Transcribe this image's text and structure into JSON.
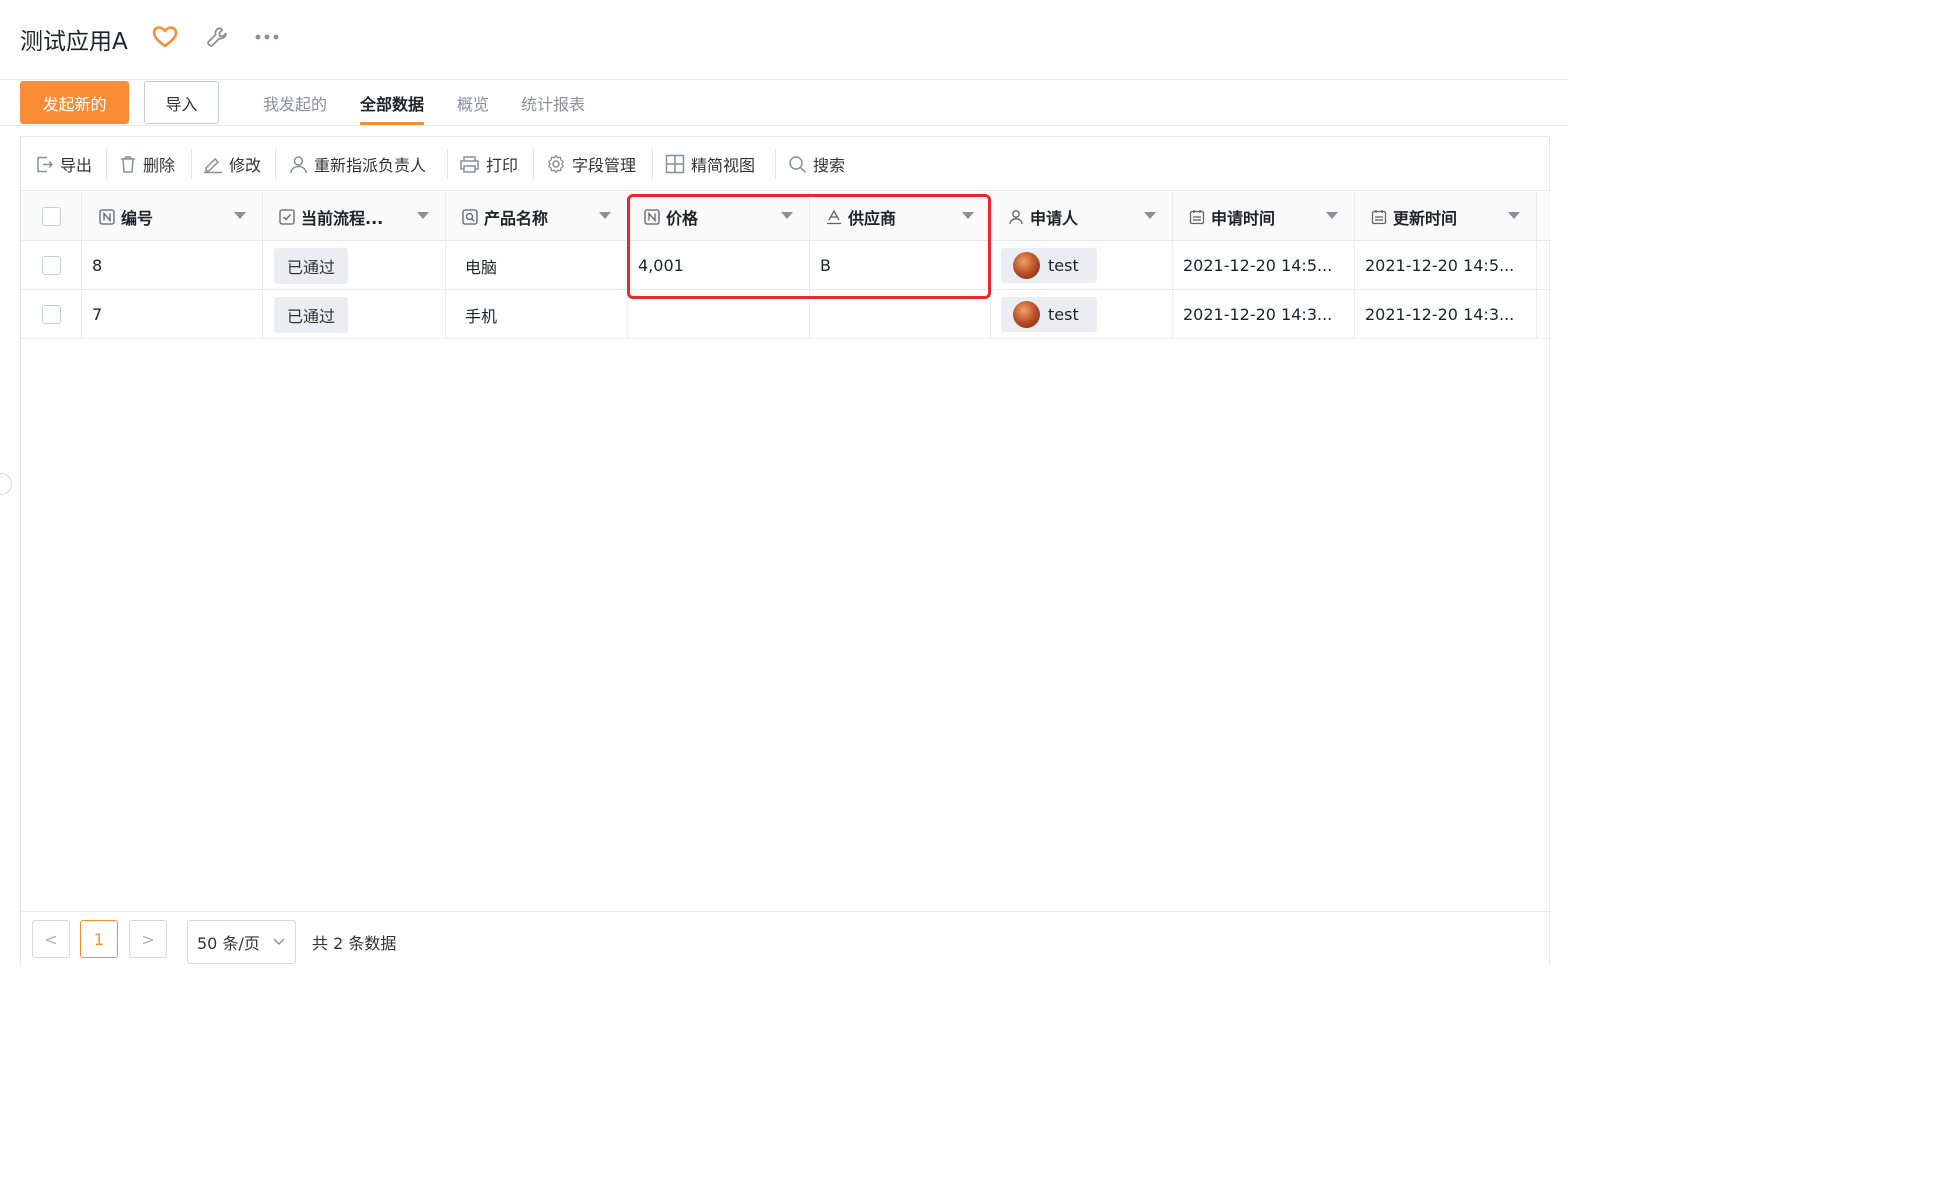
{
  "header": {
    "title": "测试应用A",
    "icons": [
      "heart-icon",
      "wrench-icon",
      "more-icon"
    ],
    "heart_color": "#fa8c35"
  },
  "actions": {
    "create_label": "发起新的",
    "import_label": "导入",
    "tabs": [
      {
        "label": "我发起的",
        "active": false
      },
      {
        "label": "全部数据",
        "active": true
      },
      {
        "label": "概览",
        "active": false
      },
      {
        "label": "统计报表",
        "active": false
      }
    ],
    "accent_color": "#fa8c35"
  },
  "toolbar": {
    "items": [
      {
        "label": "导出",
        "icon": "export-icon"
      },
      {
        "label": "删除",
        "icon": "trash-icon"
      },
      {
        "label": "修改",
        "icon": "edit-icon"
      },
      {
        "label": "重新指派负责人",
        "icon": "user-icon"
      },
      {
        "label": "打印",
        "icon": "printer-icon"
      },
      {
        "label": "字段管理",
        "icon": "gear-icon"
      },
      {
        "label": "精简视图",
        "icon": "grid-icon"
      },
      {
        "label": "搜索",
        "icon": "search-icon"
      }
    ]
  },
  "table": {
    "columns": [
      {
        "label": "编号",
        "icon": "number-field-icon"
      },
      {
        "label": "当前流程...",
        "icon": "checkbox-field-icon"
      },
      {
        "label": "产品名称",
        "icon": "link-field-icon"
      },
      {
        "label": "价格",
        "icon": "number-field-icon"
      },
      {
        "label": "供应商",
        "icon": "text-field-icon"
      },
      {
        "label": "申请人",
        "icon": "person-field-icon"
      },
      {
        "label": "申请时间",
        "icon": "calendar-icon"
      },
      {
        "label": "更新时间",
        "icon": "calendar-icon"
      }
    ],
    "rows": [
      {
        "id": "8",
        "status": "已通过",
        "product": "电脑",
        "price": "4,001",
        "supplier": "B",
        "applicant": "test",
        "applied_at": "2021-12-20 14:5...",
        "updated_at": "2021-12-20 14:5..."
      },
      {
        "id": "7",
        "status": "已通过",
        "product": "手机",
        "price": "",
        "supplier": "",
        "applicant": "test",
        "applied_at": "2021-12-20 14:3...",
        "updated_at": "2021-12-20 14:3..."
      }
    ],
    "highlight_color": "#e8282b"
  },
  "pagination": {
    "prev": "<",
    "current_page": "1",
    "next": ">",
    "page_size": "50 条/页",
    "total_text": "共 2 条数据"
  }
}
